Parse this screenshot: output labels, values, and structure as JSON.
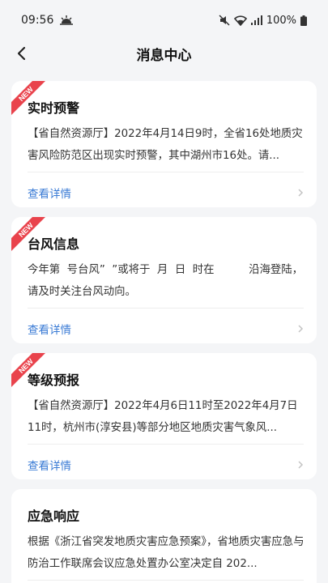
{
  "status_bar": {
    "time": "09:56",
    "battery": "100%",
    "icons": [
      "weather-icon",
      "mute-icon",
      "wifi-icon",
      "signal-icon",
      "battery-icon"
    ]
  },
  "header": {
    "title": "消息中心",
    "back_icon": "back-arrow-icon"
  },
  "colors": {
    "accent": "#3a7bd5",
    "badge": "#e9434c",
    "background": "#f4f5f7"
  },
  "messages": [
    {
      "badge": "NEW",
      "title": "实时预警",
      "body": "【省自然资源厅】2022年4月14日9时，全省16处地质灾害风险防范区出现实时预警，其中湖州市16处。请...",
      "link": "查看详情"
    },
    {
      "badge": "NEW",
      "title": "台风信息",
      "body": "今年第  号台风”  ”或将于  月  日  时在          沿海登陆，请及时关注台风动向。",
      "link": "查看详情"
    },
    {
      "badge": "NEW",
      "title": "等级预报",
      "body": "【省自然资源厅】2022年4月6日11时至2022年4月7日11时，杭州市(淳安县)等部分地区地质灾害气象风...",
      "link": "查看详情"
    },
    {
      "title": "应急响应",
      "body": "根据《浙江省突发地质灾害应急预案》，省地质灾害应急与防治工作联席会议应急处置办公室决定自 202..."
    }
  ]
}
